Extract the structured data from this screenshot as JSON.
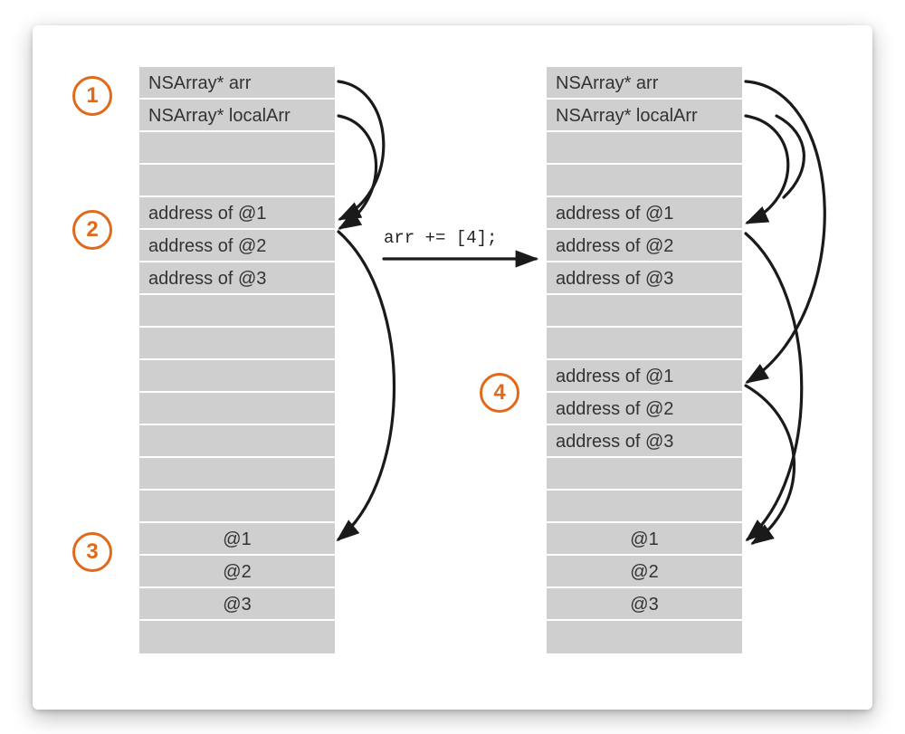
{
  "leftColumn": {
    "rows": [
      "NSArray* arr",
      "NSArray* localArr",
      "",
      "",
      "address of @1",
      "address of @2",
      "address of @3",
      "",
      "",
      "",
      "",
      "",
      "",
      "",
      "@1",
      "@2",
      "@3",
      ""
    ]
  },
  "rightColumn": {
    "rows": [
      "NSArray* arr",
      "NSArray* localArr",
      "",
      "",
      "address of @1",
      "address of @2",
      "address of @3",
      "",
      "",
      "address of @1",
      "address of @2",
      "address of @3",
      "",
      "",
      "@1",
      "@2",
      "@3",
      ""
    ]
  },
  "badges": {
    "b1": "1",
    "b2": "2",
    "b3": "3",
    "b4": "4"
  },
  "codeLabel": "arr += [4];"
}
